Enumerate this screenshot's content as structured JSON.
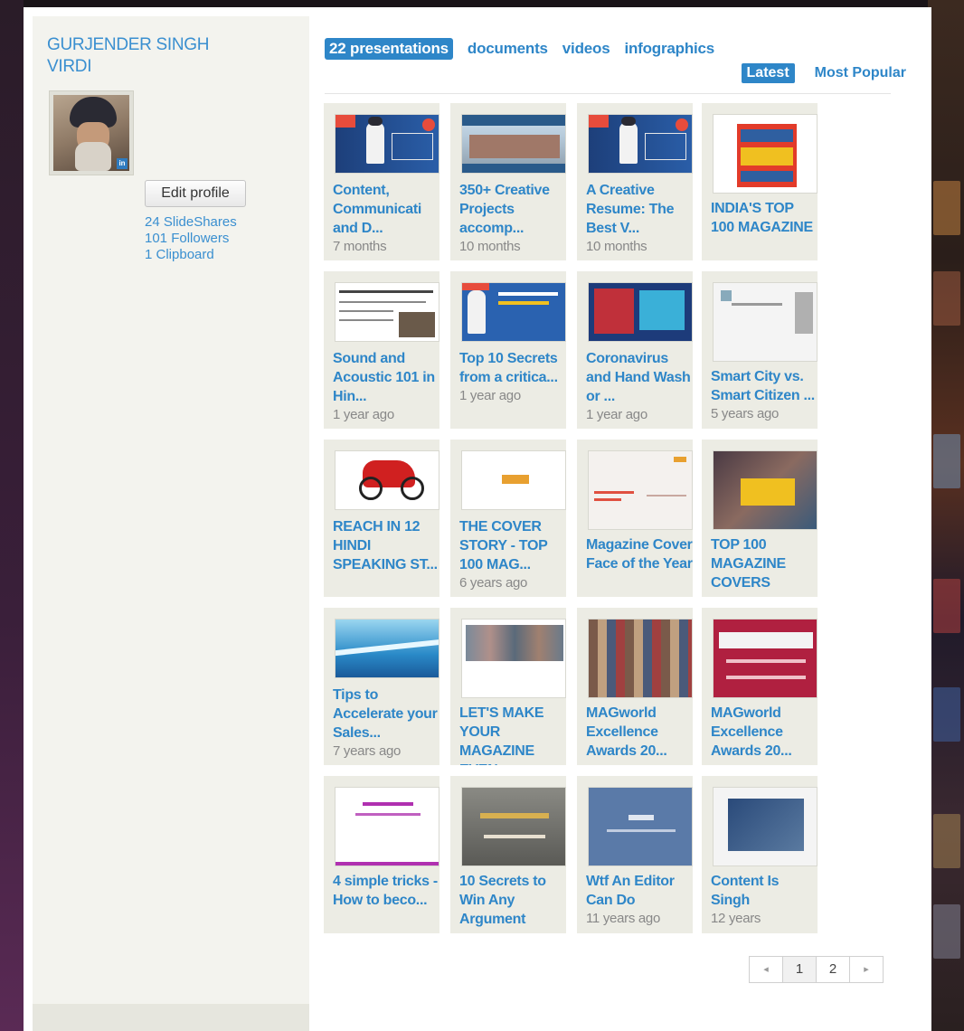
{
  "profile": {
    "name": "GURJENDER SINGH VIRDI",
    "edit_label": "Edit profile",
    "stats": [
      "24 SlideShares",
      "101 Followers",
      "1 Clipboard"
    ]
  },
  "tabs": [
    "22 presentations",
    "documents",
    "videos",
    "infographics"
  ],
  "sort": [
    "Latest",
    "Most Popular"
  ],
  "cards": [
    {
      "title": "Content, Communicati and D...",
      "date": "7 months",
      "thumb": "portfolio"
    },
    {
      "title": "350+ Creative Projects accomp...",
      "date": "10 months",
      "thumb": "building"
    },
    {
      "title": "A Creative Resume: The Best V...",
      "date": "10 months",
      "thumb": "portfolio"
    },
    {
      "title": "INDIA'S TOP 100 MAGAZINE",
      "date": "",
      "thumb": "top100"
    },
    {
      "title": "Sound and Acoustic 101 in Hin...",
      "date": "1 year ago",
      "thumb": "hindidoc"
    },
    {
      "title": "Top 10 Secrets from a critica...",
      "date": "1 year ago",
      "thumb": "secrets"
    },
    {
      "title": "Coronavirus and Hand Wash or ...",
      "date": "1 year ago",
      "thumb": "corona"
    },
    {
      "title": "Smart City vs. Smart Citizen ...",
      "date": "5 years ago",
      "thumb": "smartcity"
    },
    {
      "title": "REACH IN 12 HINDI SPEAKING ST...",
      "date": "",
      "thumb": "bike"
    },
    {
      "title": "THE COVER STORY - TOP 100 MAG...",
      "date": "6 years ago",
      "thumb": "coverlogo"
    },
    {
      "title": "Magazine Cover Face of the Year",
      "date": "",
      "thumb": "coverface"
    },
    {
      "title": "TOP 100 MAGAZINE COVERS",
      "date": "",
      "thumb": "coverstory"
    },
    {
      "title": "Tips to Accelerate your Sales...",
      "date": "7 years ago",
      "thumb": "tips"
    },
    {
      "title": "LET'S MAKE YOUR MAGAZINE EVEN...",
      "date": "",
      "thumb": "letsmake"
    },
    {
      "title": "MAGworld Excellence Awards 20...",
      "date": "",
      "thumb": "covers"
    },
    {
      "title": "MAGworld Excellence Awards 20...",
      "date": "",
      "thumb": "magworld"
    },
    {
      "title": "4 simple tricks - How to beco...",
      "date": "",
      "thumb": "tricks"
    },
    {
      "title": "10 Secrets to Win Any Argument",
      "date": "",
      "thumb": "argument"
    },
    {
      "title": "Wtf An Editor Can Do",
      "date": "11 years ago",
      "thumb": "wtf"
    },
    {
      "title": "Content Is Singh",
      "date": "12 years",
      "thumb": "contentsingh"
    }
  ],
  "pager": {
    "prev": "◂",
    "pages": [
      "1",
      "2"
    ],
    "next": "▸"
  },
  "colors": {
    "link": "#2e86c8",
    "card_bg": "#ecece4",
    "sidebar_bg": "#f3f3ee"
  }
}
